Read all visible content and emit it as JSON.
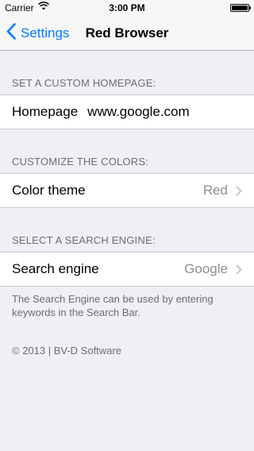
{
  "status_bar": {
    "carrier": "Carrier",
    "time": "3:00 PM",
    "wifi_icon": "wifi-icon",
    "battery_icon": "battery-icon"
  },
  "nav": {
    "back_label": "Settings",
    "title": "Red Browser",
    "accent_color": "#007aff"
  },
  "sections": {
    "homepage": {
      "header": "SET A CUSTOM HOMEPAGE:",
      "label": "Homepage",
      "value": "www.google.com"
    },
    "colors": {
      "header": "CUSTOMIZE THE COLORS:",
      "label": "Color theme",
      "value": "Red"
    },
    "search": {
      "header": "SELECT A SEARCH ENGINE:",
      "label": "Search engine",
      "value": "Google",
      "footer": "The Search Engine can be used by entering keywords in the Search Bar."
    }
  },
  "copyright": "© 2013 | BV-D Software"
}
